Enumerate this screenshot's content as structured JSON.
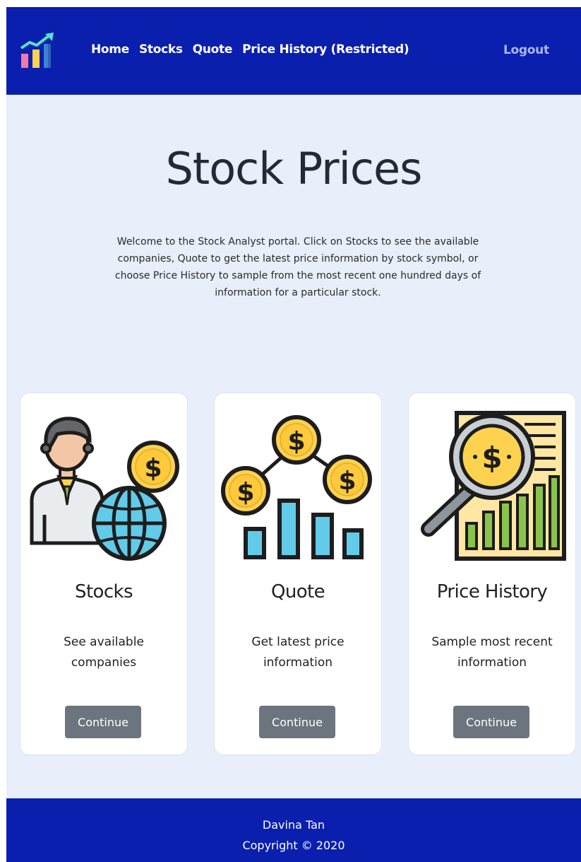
{
  "nav": {
    "links": [
      "Home",
      "Stocks",
      "Quote",
      "Price History (Restricted)"
    ],
    "logout": "Logout"
  },
  "hero": {
    "title": "Stock Prices",
    "intro": "Welcome to the Stock Analyst portal. Click on Stocks to see the available companies, Quote to get the latest price information by stock symbol, or choose Price History to sample from the most recent one hundred days of information for a particular stock."
  },
  "cards": [
    {
      "title": "Stocks",
      "description": "See available companies",
      "button": "Continue",
      "icon": "businessman-globe-coin-icon"
    },
    {
      "title": "Quote",
      "description": "Get latest price information",
      "button": "Continue",
      "icon": "coins-bar-chart-icon"
    },
    {
      "title": "Price History",
      "description": "Sample most recent information",
      "button": "Continue",
      "icon": "magnifier-report-chart-icon"
    }
  ],
  "footer": {
    "name": "Davina Tan",
    "copyright": "Copyright © 2020"
  },
  "colors": {
    "navbar": "#0a1fae",
    "page_bg": "#e8effb",
    "button": "#6c757d",
    "coin": "#fdd24e",
    "accent_blue": "#62cbe9"
  }
}
